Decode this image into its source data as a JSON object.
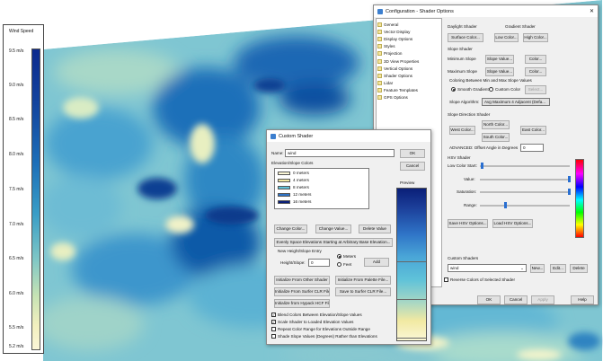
{
  "legend": {
    "title": "Wind Speed",
    "ticks": [
      "9.5 m/s",
      "9.0 m/s",
      "8.5 m/s",
      "8.0 m/s",
      "7.5 m/s",
      "7.0 m/s",
      "6.5 m/s",
      "6.0 m/s",
      "5.5 m/s",
      "5.2 m/s"
    ]
  },
  "config": {
    "title": "Configuration - Shader Options",
    "tree": [
      "General",
      "Vector Display",
      "Display Options",
      "Styles",
      "Projection",
      "3D View Properties",
      "Vertical Options",
      "Shader Options",
      "Lidar",
      "Feature Templates",
      "GPS Options"
    ],
    "daylight_label": "Daylight Shader",
    "gradient_label": "Gradient Shader",
    "surface_color": "Surface Color...",
    "low_color": "Low Color...",
    "high_color": "High Color...",
    "slope_shader": "Slope Shader",
    "min_slope": "Minimum Slope",
    "max_slope": "Maximum Slope",
    "slope_value": "Slope Value...",
    "color": "Color...",
    "coloring_between": "Coloring Between Min and Max Slope Values",
    "smooth_gradient": "Smooth Gradient",
    "custom_color": "Custom Color",
    "select": "Select...",
    "slope_algorithm": "Slope Algorithm:",
    "slope_algorithm_value": "Avg Maximum 4 Adjacent (Defa...",
    "slope_direction_shader": "Slope Direction Shader",
    "north_color": "North Color...",
    "west_color": "West Color...",
    "east_color": "East Color...",
    "south_color": "South Color...",
    "advanced_offset": "ADVANCED: Offset Angle in Degrees",
    "offset_value": "0",
    "hsv_shader": "HSV Shader",
    "low_color_start": "Low Color Start:",
    "value": "Value:",
    "saturation": "Saturation:",
    "range": "Range:",
    "save_hsv": "Save HSV Options...",
    "load_hsv": "Load HSV Options...",
    "custom_shaders": "Custom Shaders",
    "custom_value": "wind",
    "new": "New...",
    "edit": "Edit...",
    "delete": "Delete",
    "reverse": "Reverse Colors of Selected Shader",
    "ok": "OK",
    "cancel": "Cancel",
    "apply": "Apply",
    "help": "Help"
  },
  "custom": {
    "title": "Custom Shader",
    "name_label": "Name:",
    "name_value": "wind",
    "ok": "OK",
    "cancel": "Cancel",
    "elev_label": "Elevation/Slope Colors",
    "preview": "Preview",
    "rows": [
      {
        "label": "0 meters",
        "color": "#fbf7d6"
      },
      {
        "label": "4 meters",
        "color": "#f1e9a2"
      },
      {
        "label": "8 meters",
        "color": "#5fc2d9"
      },
      {
        "label": "12 meters",
        "color": "#2f74c7"
      },
      {
        "label": "16 meters",
        "color": "#0a1f78"
      }
    ],
    "change_color": "Change Color...",
    "change_value": "Change Value...",
    "delete_value": "Delete Value",
    "evenly_space": "Evenly Space Elevations Starting at Arbitrary Base Elevation...",
    "new_entry": "New Height/Slope Entry",
    "height_slope": "Height/Slope:",
    "height_value": "0",
    "meters": "Meters",
    "feet": "Feet",
    "add": "Add",
    "init_other": "Initialize From Other Shader",
    "init_palette": "Initialize From Palette File...",
    "init_surfer": "Initialize From Surfer CLR File...",
    "save_surfer": "Save to Surfer CLR File...",
    "init_hypack": "Initialize from Hypack HCF File...",
    "chk_blend": "Blend Colors Between Elevation/Slope Values",
    "chk_scale": "Scale Shader to Loaded Elevation Values",
    "chk_repeat": "Repeat Color Range for Elevations Outside Range",
    "chk_shade": "Shade Slope Values (Degrees) Rather than Elevations"
  }
}
